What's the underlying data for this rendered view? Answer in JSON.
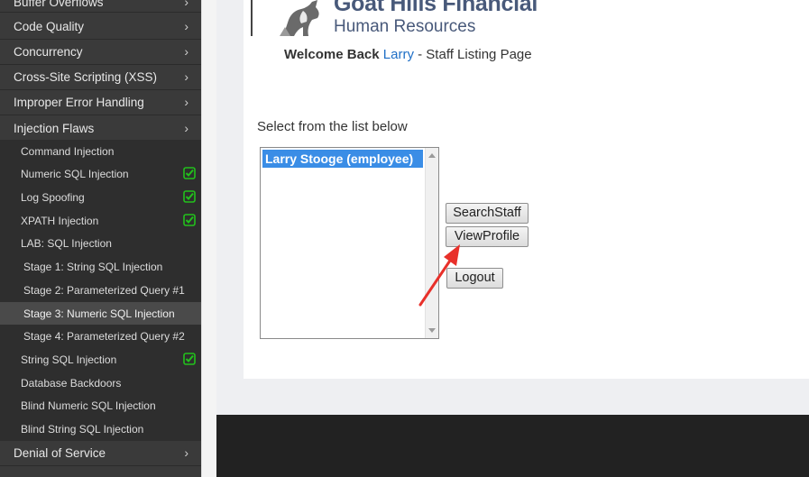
{
  "sidebar": {
    "categories_top": [
      {
        "label": "Buffer Overflows"
      },
      {
        "label": "Code Quality"
      },
      {
        "label": "Concurrency"
      },
      {
        "label": "Cross-Site Scripting (XSS)"
      },
      {
        "label": "Improper Error Handling"
      },
      {
        "label": "Injection Flaws"
      }
    ],
    "lessons": [
      {
        "label": "Command Injection",
        "completed": false
      },
      {
        "label": "Numeric SQL Injection",
        "completed": true
      },
      {
        "label": "Log Spoofing",
        "completed": true
      },
      {
        "label": "XPATH Injection",
        "completed": true
      },
      {
        "label": "LAB: SQL Injection",
        "completed": false
      },
      {
        "label": "Stage 1: String SQL Injection",
        "completed": false
      },
      {
        "label": "Stage 2: Parameterized Query #1",
        "completed": false
      },
      {
        "label": "Stage 3: Numeric SQL Injection",
        "completed": false,
        "selected": true
      },
      {
        "label": "Stage 4: Parameterized Query #2",
        "completed": false
      },
      {
        "label": "String SQL Injection",
        "completed": true
      },
      {
        "label": "Database Backdoors",
        "completed": false
      },
      {
        "label": "Blind Numeric SQL Injection",
        "completed": false
      },
      {
        "label": "Blind String SQL Injection",
        "completed": false
      }
    ],
    "categories_bottom": [
      {
        "label": "Denial of Service"
      }
    ],
    "chevron_icon": "chevron-right-icon",
    "check_icon": "green-checkbox-icon",
    "check_color": "#22c01c"
  },
  "header": {
    "company": "Goat Hills Financial",
    "department": "Human Resources",
    "brand_color": "#48597a"
  },
  "welcome": {
    "prefix": "Welcome Back",
    "user": "Larry",
    "suffix": " - Staff Listing Page"
  },
  "main": {
    "select_prompt": "Select from the list below",
    "staff_list": [
      "Larry Stooge (employee)"
    ],
    "buttons": {
      "search": "SearchStaff",
      "view": "ViewProfile",
      "logout": "Logout"
    },
    "selection_color": "#3a8de6",
    "annotation_color": "#e8302a"
  }
}
